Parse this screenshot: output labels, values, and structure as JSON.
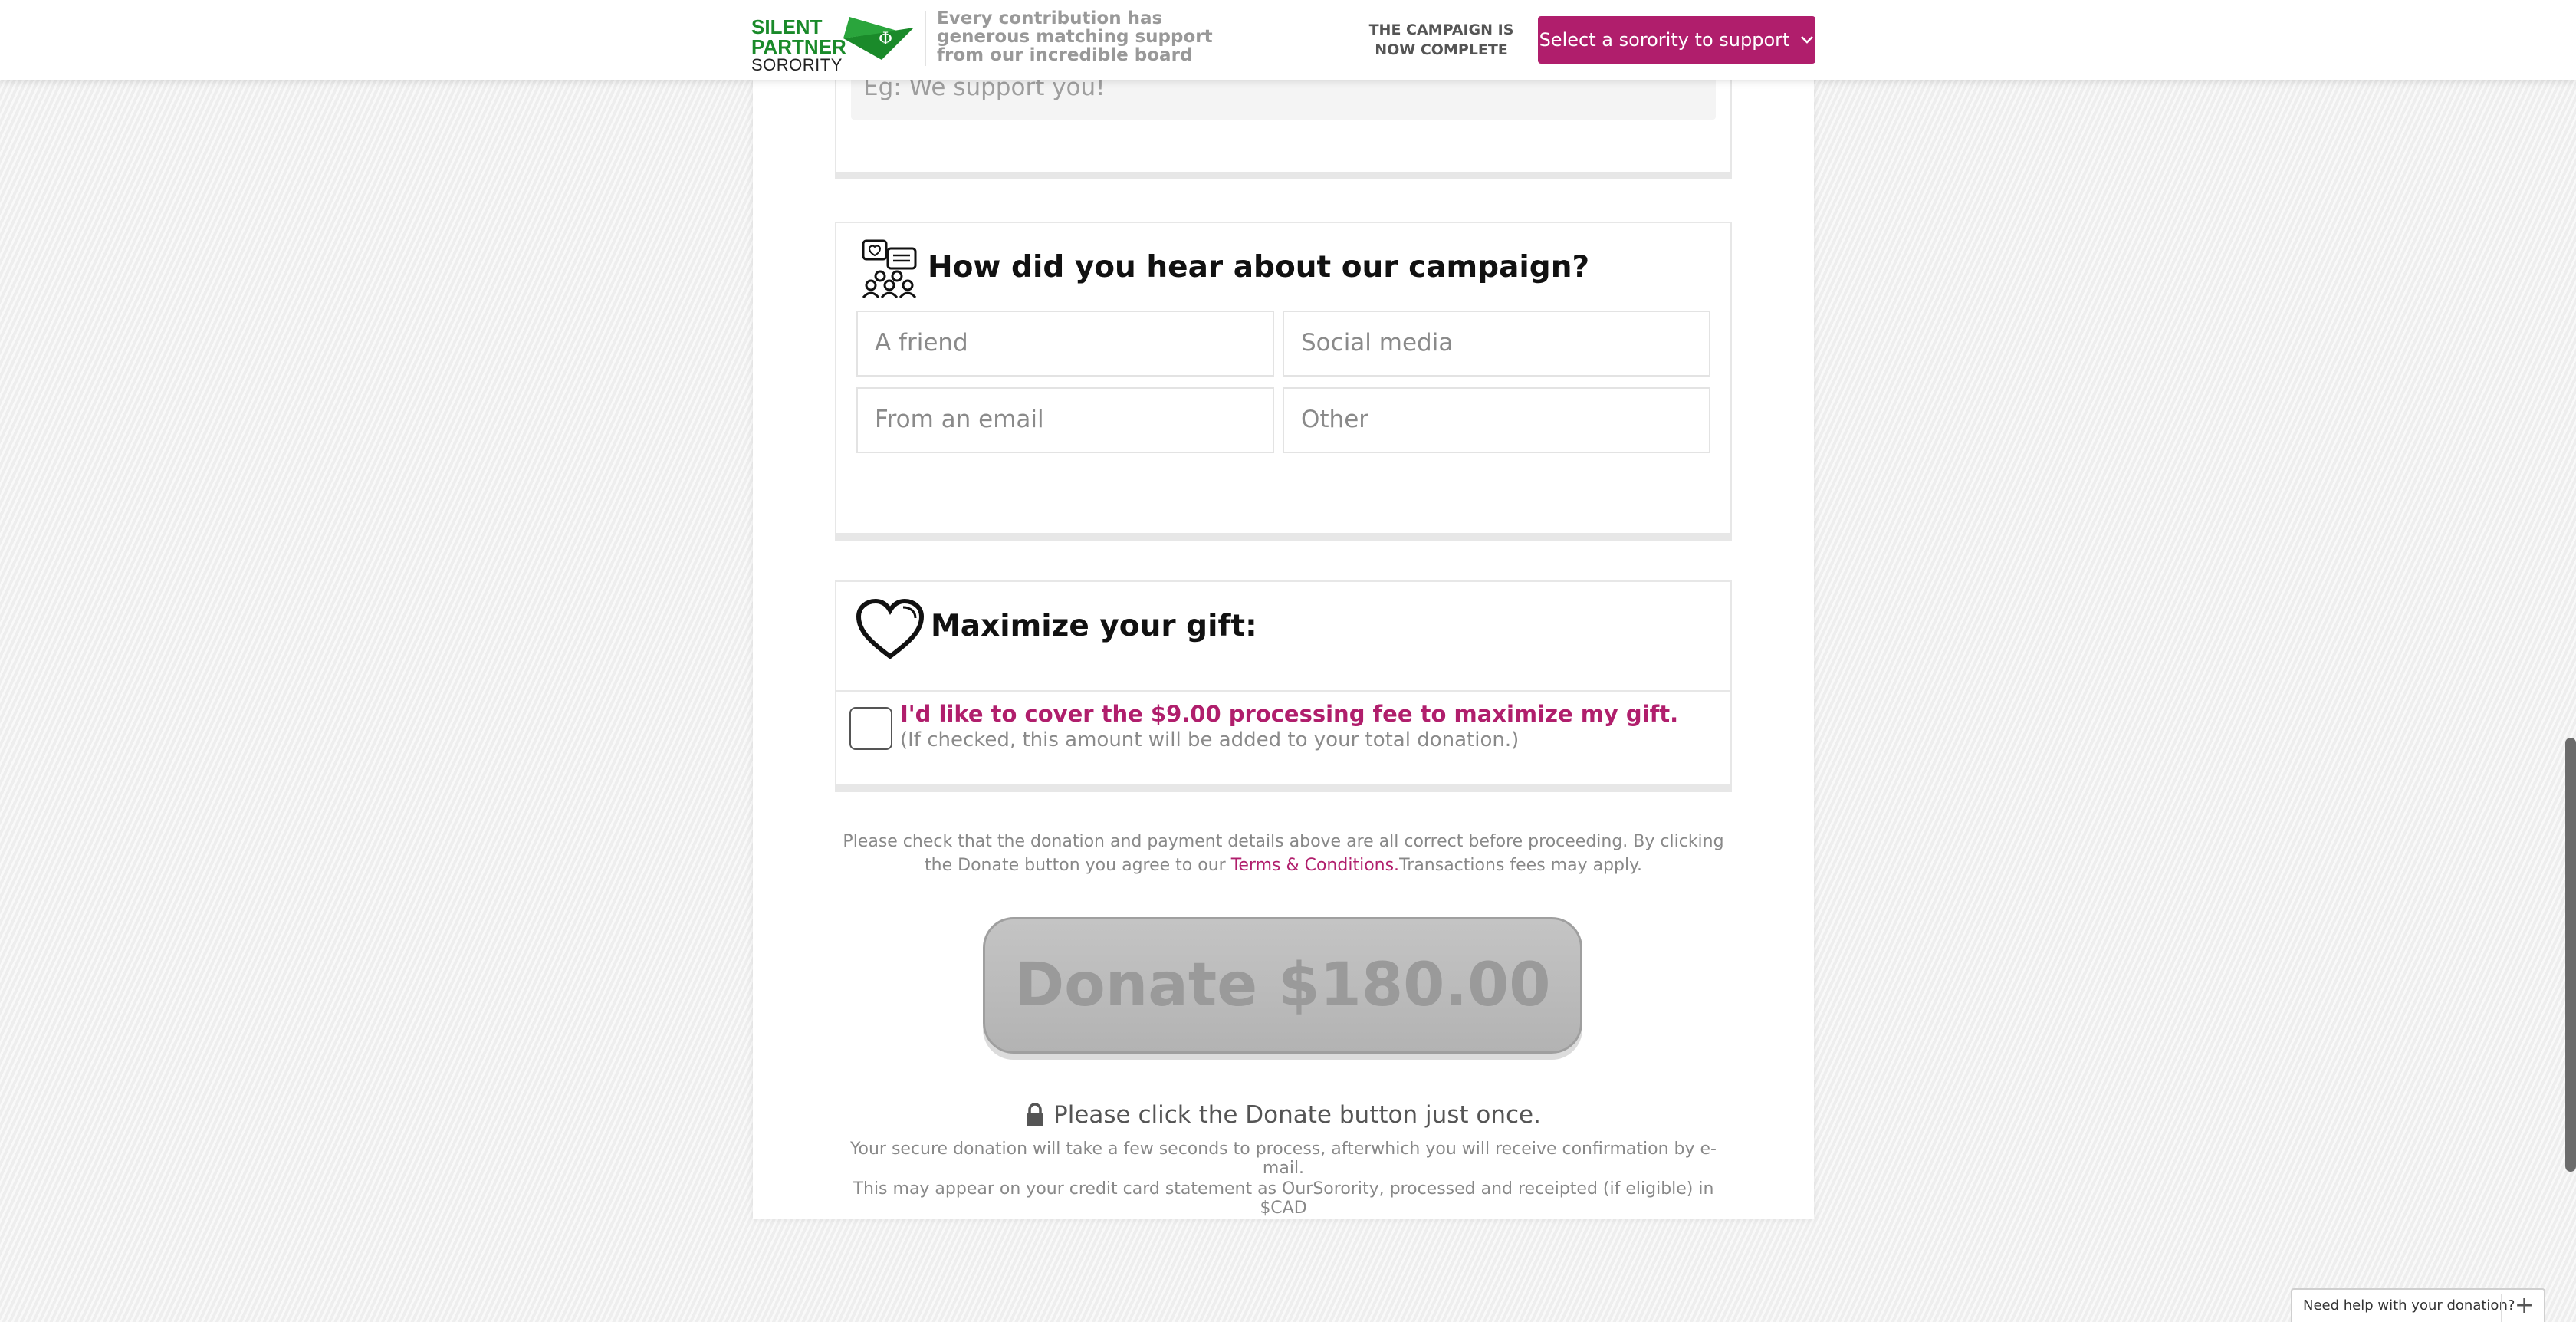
{
  "header": {
    "logo_line1": "SILENT",
    "logo_line2": "PARTNER",
    "logo_line3": "SORORITY",
    "tagline": "Every contribution has generous matching support from our incredible board",
    "status": "THE CAMPAIGN IS NOW COMPLETE",
    "select_label": "Select a sorority to support",
    "accent_color": "#b01e6c",
    "logo_color": "#1a8a2a"
  },
  "message": {
    "placeholder": "Eg: We support you!"
  },
  "hear": {
    "title": "How did you hear about our campaign?",
    "options": [
      "A friend",
      "Social media",
      "From an email",
      "Other"
    ]
  },
  "maximize": {
    "title": "Maximize your gift:",
    "fee_text": "I'd like to cover the $9.00 processing fee to maximize my gift.",
    "fee_note": "(If checked, this amount will be added to your total donation.)",
    "checked": false
  },
  "disclaimer": {
    "part1": "Please check that the donation and payment details above are all correct before proceeding. By clicking the Donate button you agree to our ",
    "link": "Terms & Conditions.",
    "part2": "Transactions fees may apply."
  },
  "donate": {
    "label": "Donate $180.00"
  },
  "footer": {
    "once": "Please click the Donate button just once.",
    "secure": "Your secure donation will take a few seconds to process, afterwhich you will receive confirmation by e-mail.",
    "statement": "This may appear on your credit card statement as OurSorority, processed and receipted (if eligible) in $CAD"
  },
  "help": {
    "label": "Need help with your donation?"
  }
}
